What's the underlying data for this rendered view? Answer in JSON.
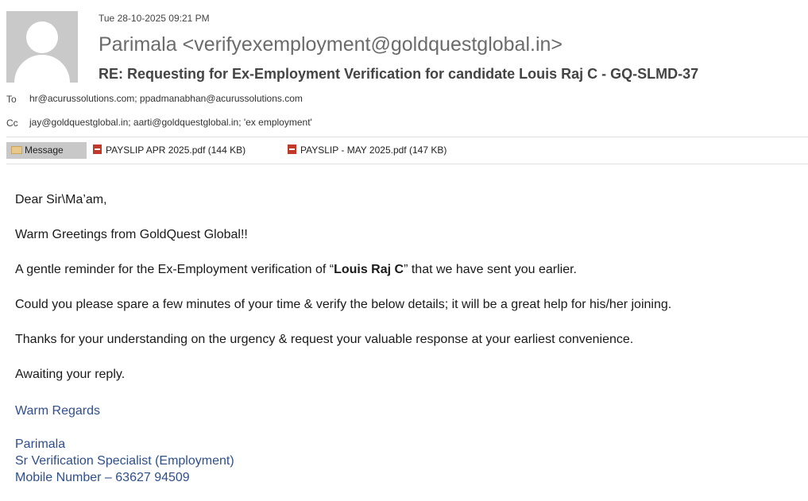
{
  "header": {
    "date": "Tue 28-10-2025 09:21 PM",
    "sender": "Parimala <verifyexemployment@goldquestglobal.in>",
    "subject": "RE: Requesting for Ex-Employment Verification for candidate Louis Raj C - GQ-SLMD-37",
    "to_label": "To",
    "to_value": "hr@acurussolutions.com; ppadmanabhan@acurussolutions.com",
    "cc_label": "Cc",
    "cc_value": "jay@goldquestglobal.in; aarti@goldquestglobal.in; 'ex employment'"
  },
  "tabs": {
    "message_label": "Message",
    "attachments": [
      {
        "label": "PAYSLIP APR 2025.pdf (144 KB)"
      },
      {
        "label": "PAYSLIP -  MAY 2025.pdf (147 KB)"
      }
    ]
  },
  "body": {
    "greeting": "Dear Sir\\Ma’am,",
    "line1": "Warm Greetings from GoldQuest Global!!",
    "line2_pre": "A gentle reminder for the Ex-Employment verification of “",
    "line2_bold": "Louis Raj C",
    "line2_post": "” that we have sent you earlier.",
    "line3": "Could you please spare a few minutes of your time & verify the below details; it will be a great help for his/her joining.",
    "line4": "Thanks for your understanding on the urgency & request your valuable response at your earliest convenience.",
    "line5": "Awaiting your reply."
  },
  "signature": {
    "regards": "Warm Regards",
    "name": "Parimala",
    "title": "Sr Verification Specialist (Employment)",
    "mobile": "Mobile Number – 63627 94509",
    "color": "#2e4f8c"
  },
  "icons": {
    "avatar": "person-avatar",
    "message": "envelope-icon",
    "attachment": "pdf-icon"
  }
}
